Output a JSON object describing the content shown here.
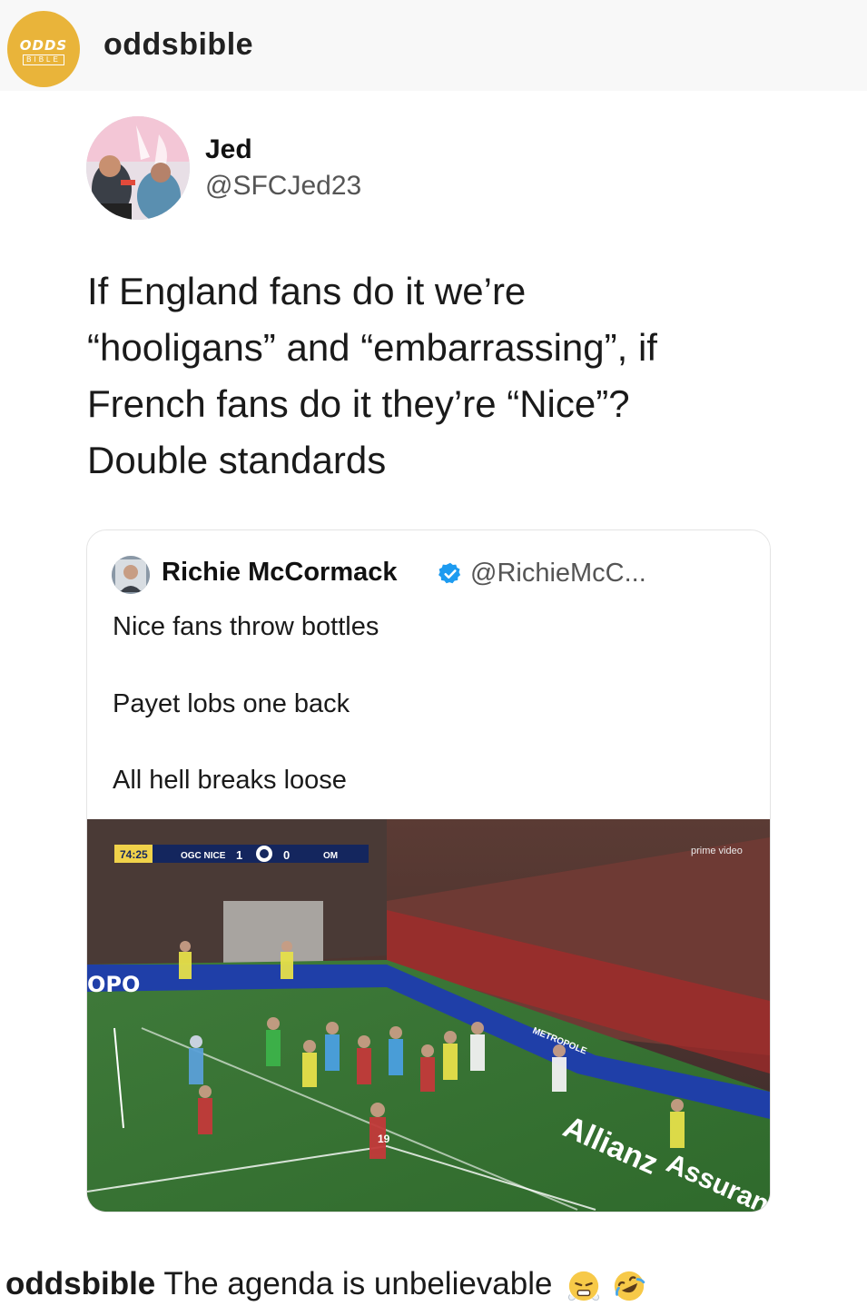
{
  "post": {
    "account": {
      "username": "oddsbible",
      "avatar_text_top": "ODDS",
      "avatar_text_bottom": "BIBLE",
      "avatar_color": "#e9b43a"
    },
    "tweet": {
      "name": "Jed",
      "handle": "@SFCJed23",
      "lines": [
        "If England fans do it we’re",
        "“hooligans” and “embarrassing”, if",
        "French fans do it they’re “Nice”?",
        "Double standards"
      ],
      "quoted": {
        "name": "Richie McCormack",
        "verified_icon": "verified-badge-icon",
        "handle": "@RichieMcC...",
        "lines": [
          "Nice fans throw bottles",
          "Payet lobs one back",
          "All hell breaks loose"
        ],
        "video": {
          "clock": "74:25",
          "home_team": "OGC NICE",
          "home_score": "1",
          "away_score": "0",
          "away_team": "OM",
          "broadcaster": "prime video",
          "board_text_1": "Allianz",
          "board_text_2": "Assurance",
          "board_text_3": "METROPOLE",
          "board_text_4": "OPO",
          "player_number": "19"
        }
      }
    },
    "caption": {
      "username": "oddsbible",
      "text": "The agenda is unbelievable",
      "emojis": [
        "face-with-steam-icon",
        "rolling-on-floor-laughing-icon"
      ]
    }
  }
}
